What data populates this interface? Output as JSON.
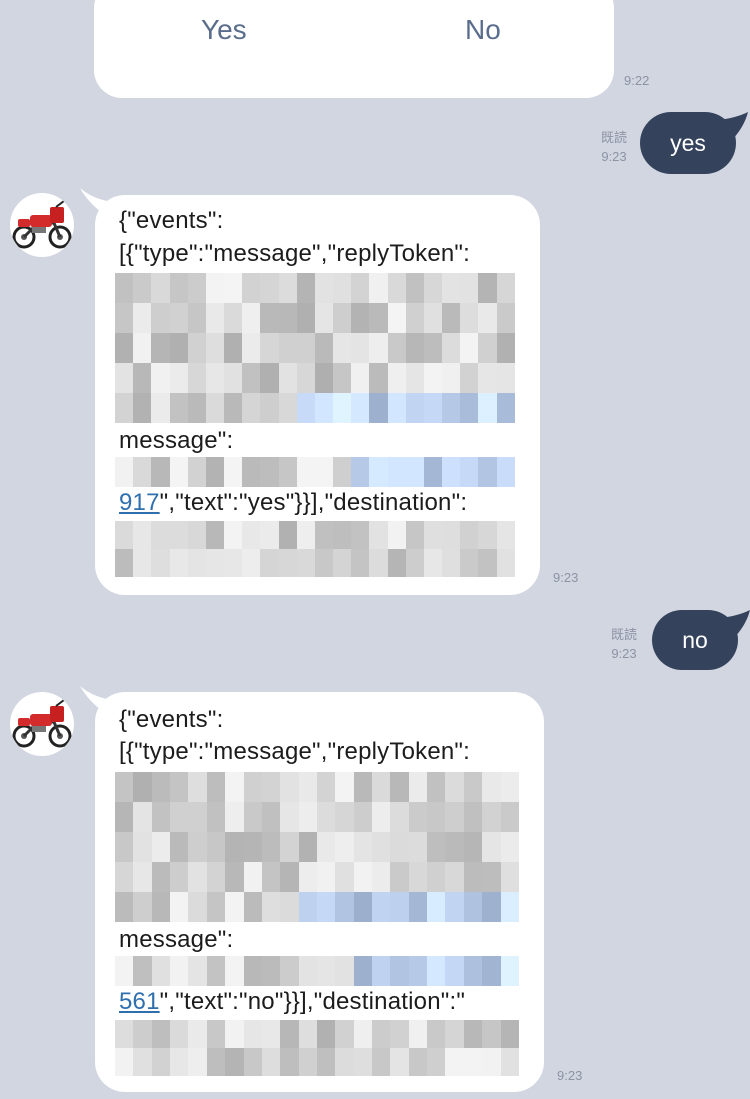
{
  "confirm": {
    "yes_label": "Yes",
    "no_label": "No",
    "time": "9:22"
  },
  "msg_out_1": {
    "read": "既読",
    "time": "9:23",
    "text": "yes"
  },
  "msg_in_1": {
    "line1": "{\"events\":",
    "line2": "[{\"type\":\"message\",\"replyToken\":",
    "line3": "message\":",
    "id_suffix": "917",
    "line4_rest": "\",\"text\":\"yes\"}}],\"destination\":",
    "time": "9:23"
  },
  "msg_out_2": {
    "read": "既読",
    "time": "9:23",
    "text": "no"
  },
  "msg_in_2": {
    "line1": "{\"events\":",
    "line2": "[{\"type\":\"message\",\"replyToken\":",
    "line3": "message\":",
    "id_suffix": "561",
    "line4_rest": "\",\"text\":\"no\"}}],\"destination\":\"",
    "time": "9:23"
  },
  "colors": {
    "background": "#d2d6e1",
    "outgoing_bubble": "#34425c",
    "incoming_bubble": "#ffffff",
    "link": "#2f6fad"
  },
  "icons": {
    "avatar": "motorcycle-icon"
  }
}
